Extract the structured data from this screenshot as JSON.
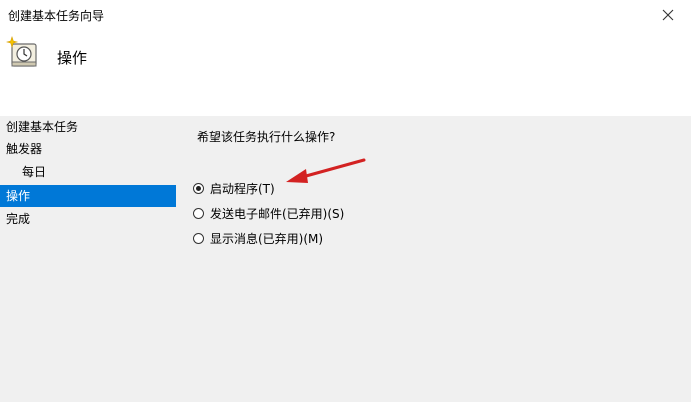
{
  "window": {
    "title": "创建基本任务向导"
  },
  "header": {
    "title": "操作",
    "icon": "clock-wizard-icon"
  },
  "sidebar": {
    "items": [
      {
        "label": "创建基本任务"
      },
      {
        "label": "触发器"
      },
      {
        "label": "每日"
      },
      {
        "label": "操作",
        "active": true
      },
      {
        "label": "完成"
      }
    ]
  },
  "main": {
    "question": "希望该任务执行什么操作?",
    "options": [
      {
        "label": "启动程序(T)",
        "selected": true
      },
      {
        "label": "发送电子邮件(已弃用)(S)",
        "selected": false
      },
      {
        "label": "显示消息(已弃用)(M)",
        "selected": false
      }
    ]
  },
  "colors": {
    "accent": "#0078d7",
    "annotation_arrow": "#d32222"
  }
}
